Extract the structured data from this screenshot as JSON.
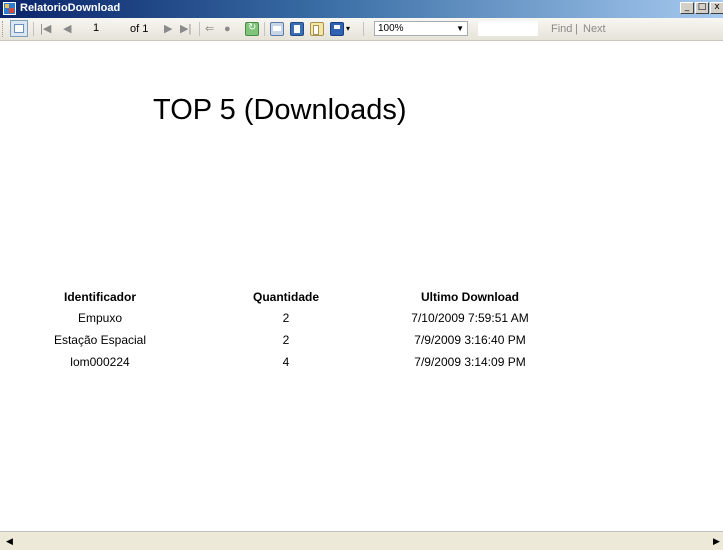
{
  "window": {
    "title": "RelatorioDownload"
  },
  "toolbar": {
    "page_current": "1",
    "page_of": "of 1",
    "zoom": "100%",
    "find_label": "Find",
    "next_label": "Next",
    "separator_find": "|"
  },
  "report": {
    "title": "TOP 5 (Downloads)",
    "columns": [
      "Identificador",
      "Quantidade",
      "Ultimo Download"
    ],
    "rows": [
      [
        "Empuxo",
        "2",
        "7/10/2009 7:59:51 AM"
      ],
      [
        "Estação Espacial",
        "2",
        "7/9/2009 3:16:40 PM"
      ],
      [
        "lom000224",
        "4",
        "7/9/2009 3:14:09 PM"
      ]
    ]
  },
  "icons": {
    "app": "report-viewer-icon",
    "first": "first-page-icon",
    "prev": "previous-page-icon",
    "next": "next-page-icon",
    "last": "last-page-icon",
    "back": "back-icon",
    "stop": "stop-icon",
    "refresh": "refresh-icon",
    "print": "print-icon",
    "print_layout": "print-layout-icon",
    "page_setup": "page-setup-icon",
    "export": "export-icon"
  }
}
